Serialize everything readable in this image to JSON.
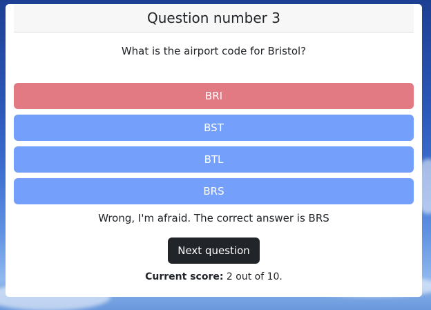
{
  "header": {
    "title": "Question number 3"
  },
  "question": {
    "text": "What is the airport code for Bristol?"
  },
  "answers": [
    {
      "label": "BRI",
      "state": "wrong-selected",
      "color": "#e27a84"
    },
    {
      "label": "BST",
      "state": "default",
      "color": "#74a0fb"
    },
    {
      "label": "BTL",
      "state": "default",
      "color": "#74a0fb"
    },
    {
      "label": "BRS",
      "state": "default",
      "color": "#74a0fb"
    }
  ],
  "feedback": {
    "text": "Wrong, I'm afraid. The correct answer is BRS"
  },
  "next_button": {
    "label": "Next question",
    "color": "#212529"
  },
  "score": {
    "label": "Current score:",
    "value": "2 out of 10."
  },
  "colors": {
    "wrong": "#e27a84",
    "answer": "#74a0fb",
    "dark": "#212529"
  }
}
